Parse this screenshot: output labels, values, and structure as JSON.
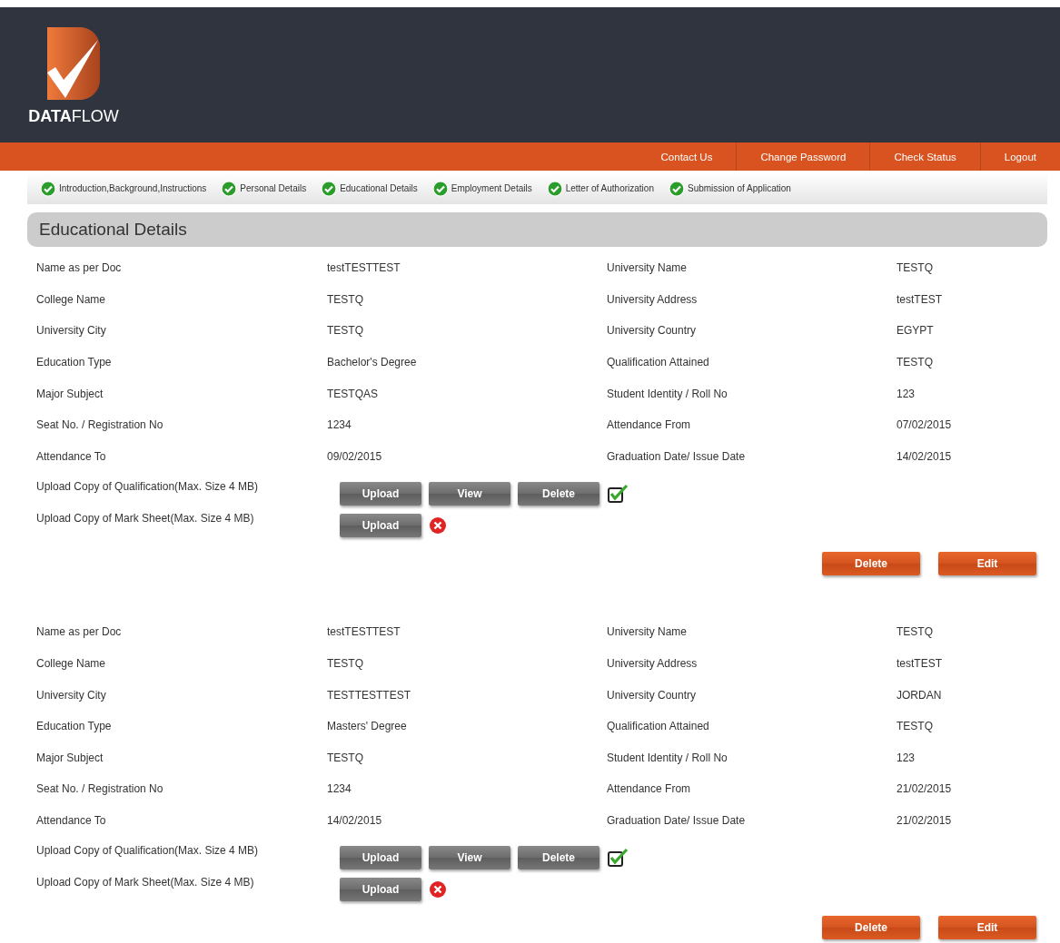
{
  "logo": {
    "text": "**DATA**FLOW"
  },
  "nav": [
    "Contact Us",
    "Change Password",
    "Check Status",
    "Logout"
  ],
  "steps": [
    {
      "label": "Introduction,Background,Instructions",
      "completed": true
    },
    {
      "label": "Personal Details",
      "completed": true
    },
    {
      "label": "Educational Details",
      "completed": true
    },
    {
      "label": "Employment Details",
      "completed": true
    },
    {
      "label": "Letter of Authorization",
      "completed": true
    },
    {
      "label": "Submission of Application",
      "completed": true
    }
  ],
  "section_title": "Educational Details",
  "records": [
    {
      "fields": [
        [
          "Name as per Doc",
          "testTESTTEST",
          "University Name",
          "TESTQ"
        ],
        [
          "College Name",
          "TESTQ",
          "University Address",
          "testTEST"
        ],
        [
          "University City",
          "TESTQ",
          "University Country",
          "EGYPT"
        ],
        [
          "Education Type",
          "Bachelor's Degree",
          "Qualification Attained",
          "TESTQ"
        ],
        [
          "Major Subject",
          "TESTQAS",
          "Student Identity / Roll No",
          "123"
        ],
        [
          "Seat No. / Registration No",
          "1234",
          "Attendance From",
          "07/02/2015"
        ],
        [
          "Attendance To",
          "09/02/2015",
          "Graduation Date/ Issue Date",
          "14/02/2015"
        ]
      ],
      "uploads": [
        {
          "label": "Upload Copy of Qualification(Max. Size 4 MB)",
          "buttons": [
            "Upload",
            "View",
            "Delete"
          ],
          "uploaded": true
        },
        {
          "label": "Upload Copy of Mark Sheet(Max. Size 4 MB)",
          "buttons": [
            "Upload"
          ],
          "uploaded": false
        }
      ],
      "actions": [
        "Delete",
        "Edit"
      ]
    },
    {
      "fields": [
        [
          "Name as per Doc",
          "testTESTTEST",
          "University Name",
          "TESTQ"
        ],
        [
          "College Name",
          "TESTQ",
          "University Address",
          "testTEST"
        ],
        [
          "University City",
          "TESTTESTTEST",
          "University Country",
          "JORDAN"
        ],
        [
          "Education Type",
          "Masters' Degree",
          "Qualification Attained",
          "TESTQ"
        ],
        [
          "Major Subject",
          "TESTQ",
          "Student Identity / Roll No",
          "123"
        ],
        [
          "Seat No. / Registration No",
          "1234",
          "Attendance From",
          "21/02/2015"
        ],
        [
          "Attendance To",
          "14/02/2015",
          "Graduation Date/ Issue Date",
          "21/02/2015"
        ]
      ],
      "uploads": [
        {
          "label": "Upload Copy of Qualification(Max. Size 4 MB)",
          "buttons": [
            "Upload",
            "View",
            "Delete"
          ],
          "uploaded": true
        },
        {
          "label": "Upload Copy of Mark Sheet(Max. Size 4 MB)",
          "buttons": [
            "Upload"
          ],
          "uploaded": false
        }
      ],
      "actions": [
        "Delete",
        "Edit"
      ]
    }
  ]
}
